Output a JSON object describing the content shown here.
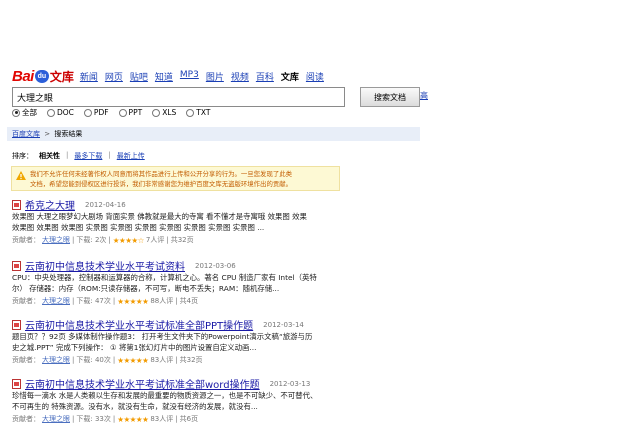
{
  "logo": {
    "bai": "Bai",
    "du": "du",
    "wenku": "文库"
  },
  "nav": [
    {
      "label": "新闻",
      "current": false
    },
    {
      "label": "网页",
      "current": false
    },
    {
      "label": "贴吧",
      "current": false
    },
    {
      "label": "知道",
      "current": false
    },
    {
      "label": "MP3",
      "current": false
    },
    {
      "label": "图片",
      "current": false
    },
    {
      "label": "视频",
      "current": false
    },
    {
      "label": "百科",
      "current": false
    },
    {
      "label": "文库",
      "current": true
    },
    {
      "label": "阅读",
      "current": false
    }
  ],
  "search": {
    "value": "大理之眼",
    "button": "搜索文档",
    "advanced": "高"
  },
  "types": [
    {
      "label": "全部",
      "checked": true
    },
    {
      "label": "DOC",
      "checked": false
    },
    {
      "label": "PDF",
      "checked": false
    },
    {
      "label": "PPT",
      "checked": false
    },
    {
      "label": "XLS",
      "checked": false
    },
    {
      "label": "TXT",
      "checked": false
    }
  ],
  "breadcrumb": {
    "home": "百度文库",
    "sep": ">",
    "current": "搜索结果"
  },
  "sort": {
    "label": "排序：",
    "options": [
      "相关性",
      "最多下载",
      "最新上传"
    ]
  },
  "notice": {
    "line1": "我们不允许任何未经著作权人同意而将其作品进行上传和公开分享的行为。一旦您发现了此类",
    "line2": "文档，希望您能到侵权区进行投诉，我们非常感谢您为维护百度文库无盗版环境作出的贡献。"
  },
  "results": [
    {
      "title_pre": "希克之大理",
      "title_hl": "",
      "date": "2012-04-16",
      "lines": [
        "效果图 大理之眼梦幻大剧场 背面实景 佛教就是最大的寺寓 看不懂才是寺寓哦 效果图 效果",
        "效果图 效果图 效果图 实景图 实景图 实景图 实景图 实景图 实景图 实景图 ..."
      ],
      "contributor_label": "贡献者：",
      "contributor": "大理之眼",
      "downloads": "下载: 2次",
      "rating": "7人评",
      "pages": "共32页",
      "stars": 4
    },
    {
      "title_pre": "云南初中信息技术学业水平考试资料",
      "title_hl": "",
      "date": "2012-03-06",
      "lines": [
        "CPU：中央处理器，控制器和运算器的合称，计算机之心。著名 CPU 制造厂家有 Intel（英特",
        "尔） 存储器：内存（ROM:只读存储器，不可写，断电不丢失；RAM：随机存储..."
      ],
      "contributor_label": "贡献者：",
      "contributor": "大理之眼",
      "downloads": "下载: 47次",
      "rating": "88人评",
      "pages": "共4页",
      "stars": 5
    },
    {
      "title_pre": "云南初中信息技术学业水平考试标准全部PPT操作题",
      "title_hl": "",
      "date": "2012-03-14",
      "lines": [
        "题目页？？92页 多媒体制作操作题3： 打开考生文件夹下的Powerpoint演示文稿“旅游与历",
        "史之城.PPT” 完成下列操作： ① 将第1张幻灯片中的图片设置自定义动画..."
      ],
      "contributor_label": "贡献者：",
      "contributor": "大理之眼",
      "downloads": "下载: 40次",
      "rating": "83人评",
      "pages": "共32页",
      "stars": 5
    },
    {
      "title_pre": "云南初中信息技术学业水平考试标准全部word操作题",
      "title_hl": "",
      "date": "2012-03-13",
      "lines": [
        "珍惜每一滴水 水是人类赖以生存和发展的最重要的物质资源之一，也是不可缺少、不可替代、",
        "不可再生的 特殊资源。没有水，就没有生命，就没有经济的发展，就没有..."
      ],
      "contributor_label": "贡献者：",
      "contributor": "大理之眼",
      "downloads": "下载: 33次",
      "rating": "83人评",
      "pages": "共6页",
      "stars": 5
    }
  ]
}
